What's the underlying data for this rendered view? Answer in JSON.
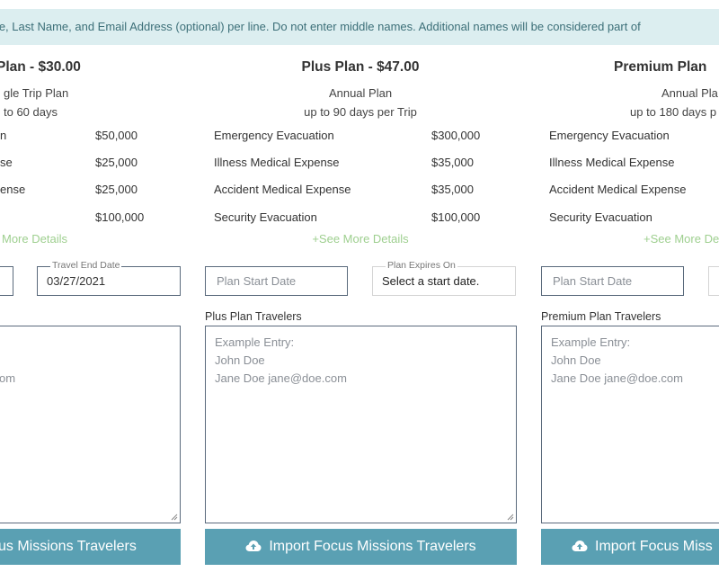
{
  "banner": {
    "text": "me, Last Name, and Email Address (optional) per line. Do not enter middle names. Additional names will be considered part of"
  },
  "plans": [
    {
      "title": "Plan - $30.00",
      "type": "gle Trip Plan",
      "duration": "to 60 days",
      "coverages": [
        {
          "label": "n",
          "amount": "$50,000"
        },
        {
          "label": "se",
          "amount": "$25,000"
        },
        {
          "label": "ense",
          "amount": "$25,000"
        },
        {
          "label": "",
          "amount": "$100,000"
        }
      ],
      "details_link": "More Details",
      "end_date_legend": "Travel End Date",
      "end_date_value": "03/27/2021",
      "example_email_fragment": "om",
      "import_button": "us Missions Travelers"
    },
    {
      "title": "Plus Plan - $47.00",
      "type": "Annual Plan",
      "duration": "up to 90 days per Trip",
      "coverages": [
        {
          "label": "Emergency Evacuation",
          "amount": "$300,000"
        },
        {
          "label": "Illness Medical Expense",
          "amount": "$35,000"
        },
        {
          "label": "Accident Medical Expense",
          "amount": "$35,000"
        },
        {
          "label": "Security Evacuation",
          "amount": "$100,000"
        }
      ],
      "details_link": "+See More Details",
      "start_date_placeholder": "Plan Start Date",
      "expires_legend": "Plan Expires On",
      "expires_value": "Select a start date.",
      "travelers_label": "Plus Plan Travelers",
      "example_lines": [
        "Example Entry:",
        "John Doe",
        "Jane Doe jane@doe.com"
      ],
      "import_button": "Import Focus Missions Travelers"
    },
    {
      "title": "Premium Plan",
      "type": "Annual Pla",
      "duration": "up to 180 days p",
      "coverages": [
        {
          "label": "Emergency Evacuation"
        },
        {
          "label": "Illness Medical Expense"
        },
        {
          "label": "Accident Medical Expense"
        },
        {
          "label": "Security Evacuation"
        }
      ],
      "details_link": "+See More De",
      "start_date_placeholder": "Plan Start Date",
      "travelers_label": "Premium Plan Travelers",
      "example_lines": [
        "Example Entry:",
        "John Doe",
        "Jane Doe jane@doe.com"
      ],
      "import_button": "Import Focus Miss"
    }
  ],
  "colors": {
    "banner_bg": "#dceef0",
    "banner_text": "#3c6f78",
    "button_bg": "#5aa0b3",
    "details_link": "#9ecf8f",
    "field_border": "#5a6a7c"
  }
}
